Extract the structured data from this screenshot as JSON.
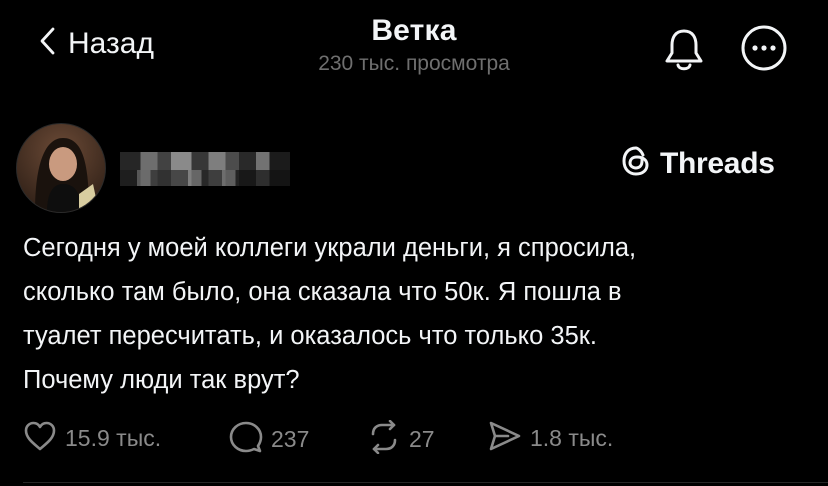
{
  "header": {
    "back_label": "Назад",
    "title": "Ветка",
    "subtitle": "230 тыс. просмотра"
  },
  "post": {
    "threads_label": "Threads",
    "text_lines": [
      "Сегодня у моей коллеги украли деньги, я спросила,",
      "сколько там было, она сказала что 50к. Я пошла в",
      "туалет пересчитать, и оказалось что только 35к.",
      "Почему люди так врут?"
    ],
    "stats": {
      "likes": "15.9 тыс.",
      "replies": "237",
      "reposts": "27",
      "shares": "1.8 тыс."
    }
  },
  "colors": {
    "background": "#000000",
    "text": "#f3f5f7",
    "muted": "#8a8a8a",
    "subtitle": "#6f6f6f"
  },
  "icons": [
    "chevron-left-icon",
    "bell-icon",
    "more-icon",
    "threads-logo-icon",
    "heart-icon",
    "comment-icon",
    "repost-icon",
    "share-icon"
  ]
}
